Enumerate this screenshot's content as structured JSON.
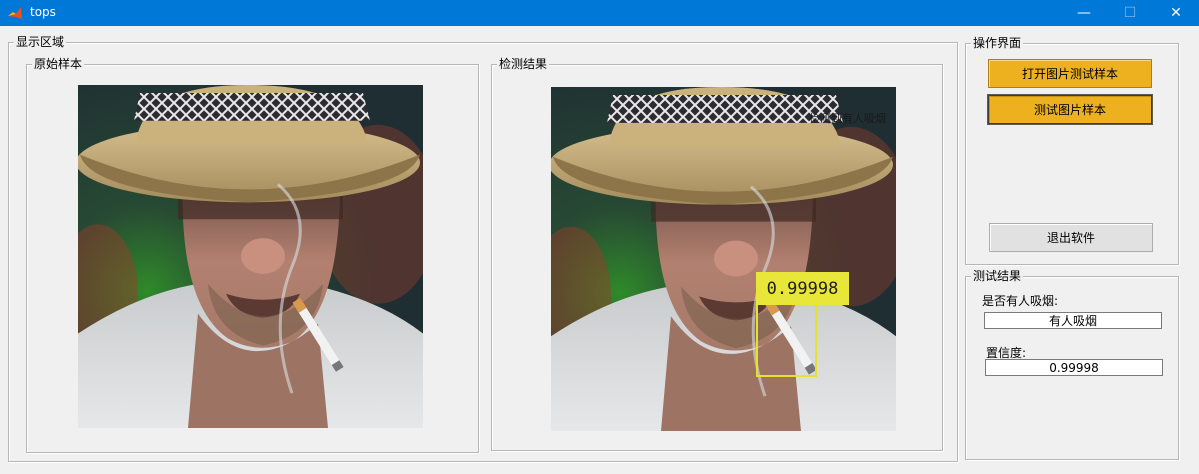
{
  "window": {
    "title": "tops",
    "minimize_glyph": "—",
    "maximize_glyph": "☐",
    "close_glyph": "✕"
  },
  "display_area": {
    "title": "显示区域",
    "original_panel": {
      "title": "原始样本"
    },
    "result_panel": {
      "title": "检测结果",
      "overlay_text": "检测到有人吸烟",
      "detection_score": "0.99998"
    }
  },
  "operation_panel": {
    "title": "操作界面",
    "open_button_label": "打开图片测试样本",
    "test_button_label": "测试图片样本",
    "exit_button_label": "退出软件"
  },
  "test_result_panel": {
    "title": "测试结果",
    "smoking_label": "是否有人吸烟:",
    "smoking_value": "有人吸烟",
    "confidence_label": "置信度:",
    "confidence_value": "0.99998"
  },
  "colors": {
    "titlebar": "#0078d7",
    "button_accent": "#edb120",
    "detection_box": "#e6e22a"
  },
  "icons": [
    "matlab-icon",
    "minimize-icon",
    "maximize-icon",
    "close-icon"
  ]
}
